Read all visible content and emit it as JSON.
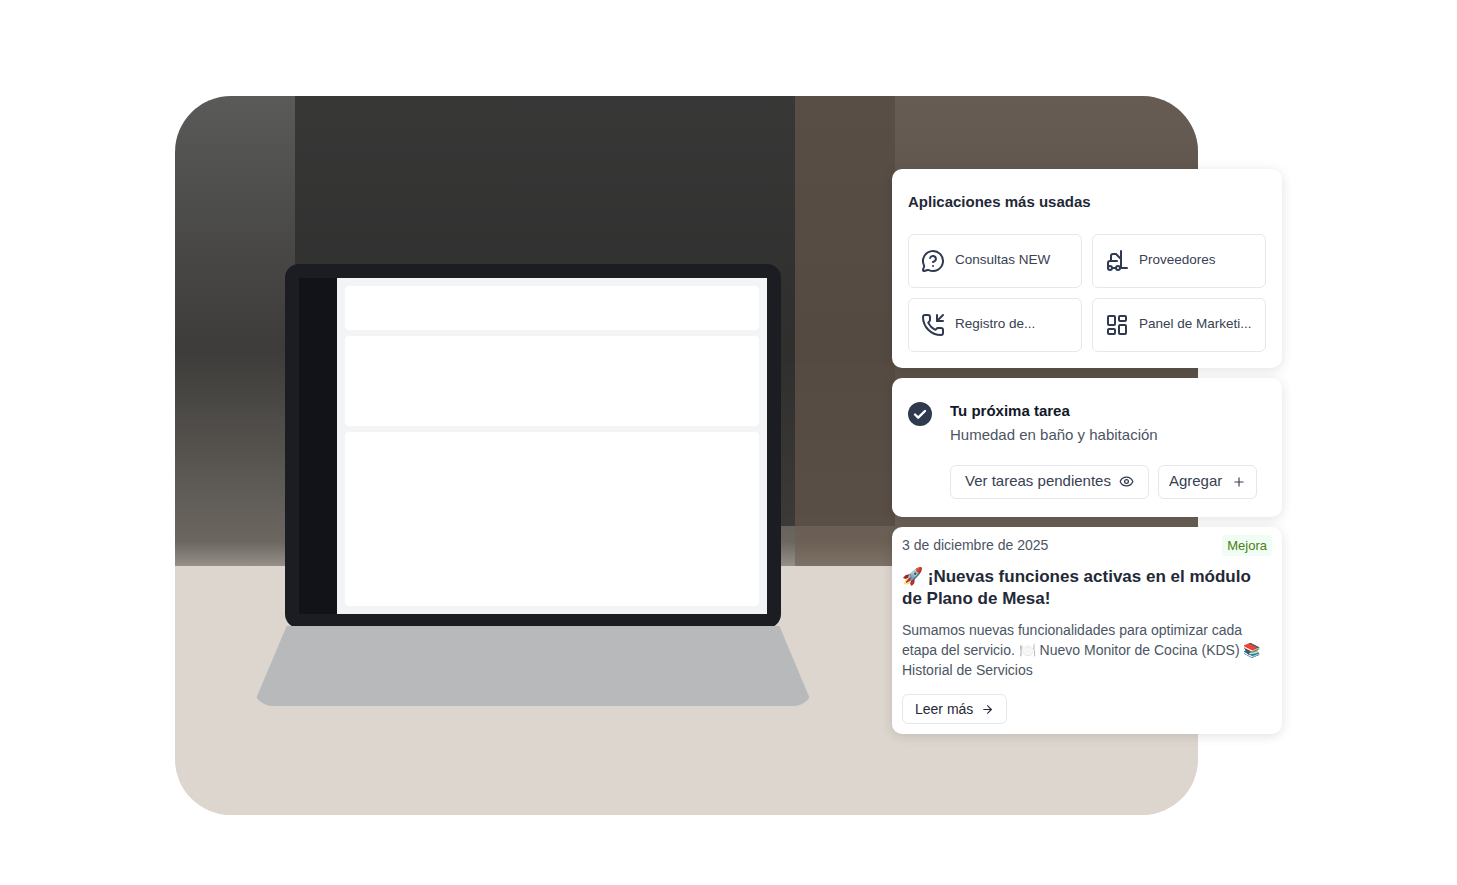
{
  "most_used_apps": {
    "title": "Aplicaciones más usadas",
    "items": [
      {
        "label": "Consultas NEW"
      },
      {
        "label": "Proveedores"
      },
      {
        "label": "Registro de..."
      },
      {
        "label": "Panel de Marketi..."
      }
    ]
  },
  "next_task": {
    "title": "Tu próxima tarea",
    "task": "Humedad en baño y habitación",
    "buttons": [
      {
        "label": "Ver tareas pendientes"
      },
      {
        "label": "Agregar"
      }
    ]
  },
  "news": {
    "date": "3 de diciembre de 2025",
    "badge": "Mejora",
    "title": "🚀 ¡Nuevas funciones activas en el módulo de Plano de Mesa!",
    "body": "Sumamos nuevas funcionalidades para optimizar cada etapa del servicio. 🍽️ Nuevo Monitor de Cocina (KDS) 📚 Historial de Servicios",
    "button": "Leer más"
  }
}
